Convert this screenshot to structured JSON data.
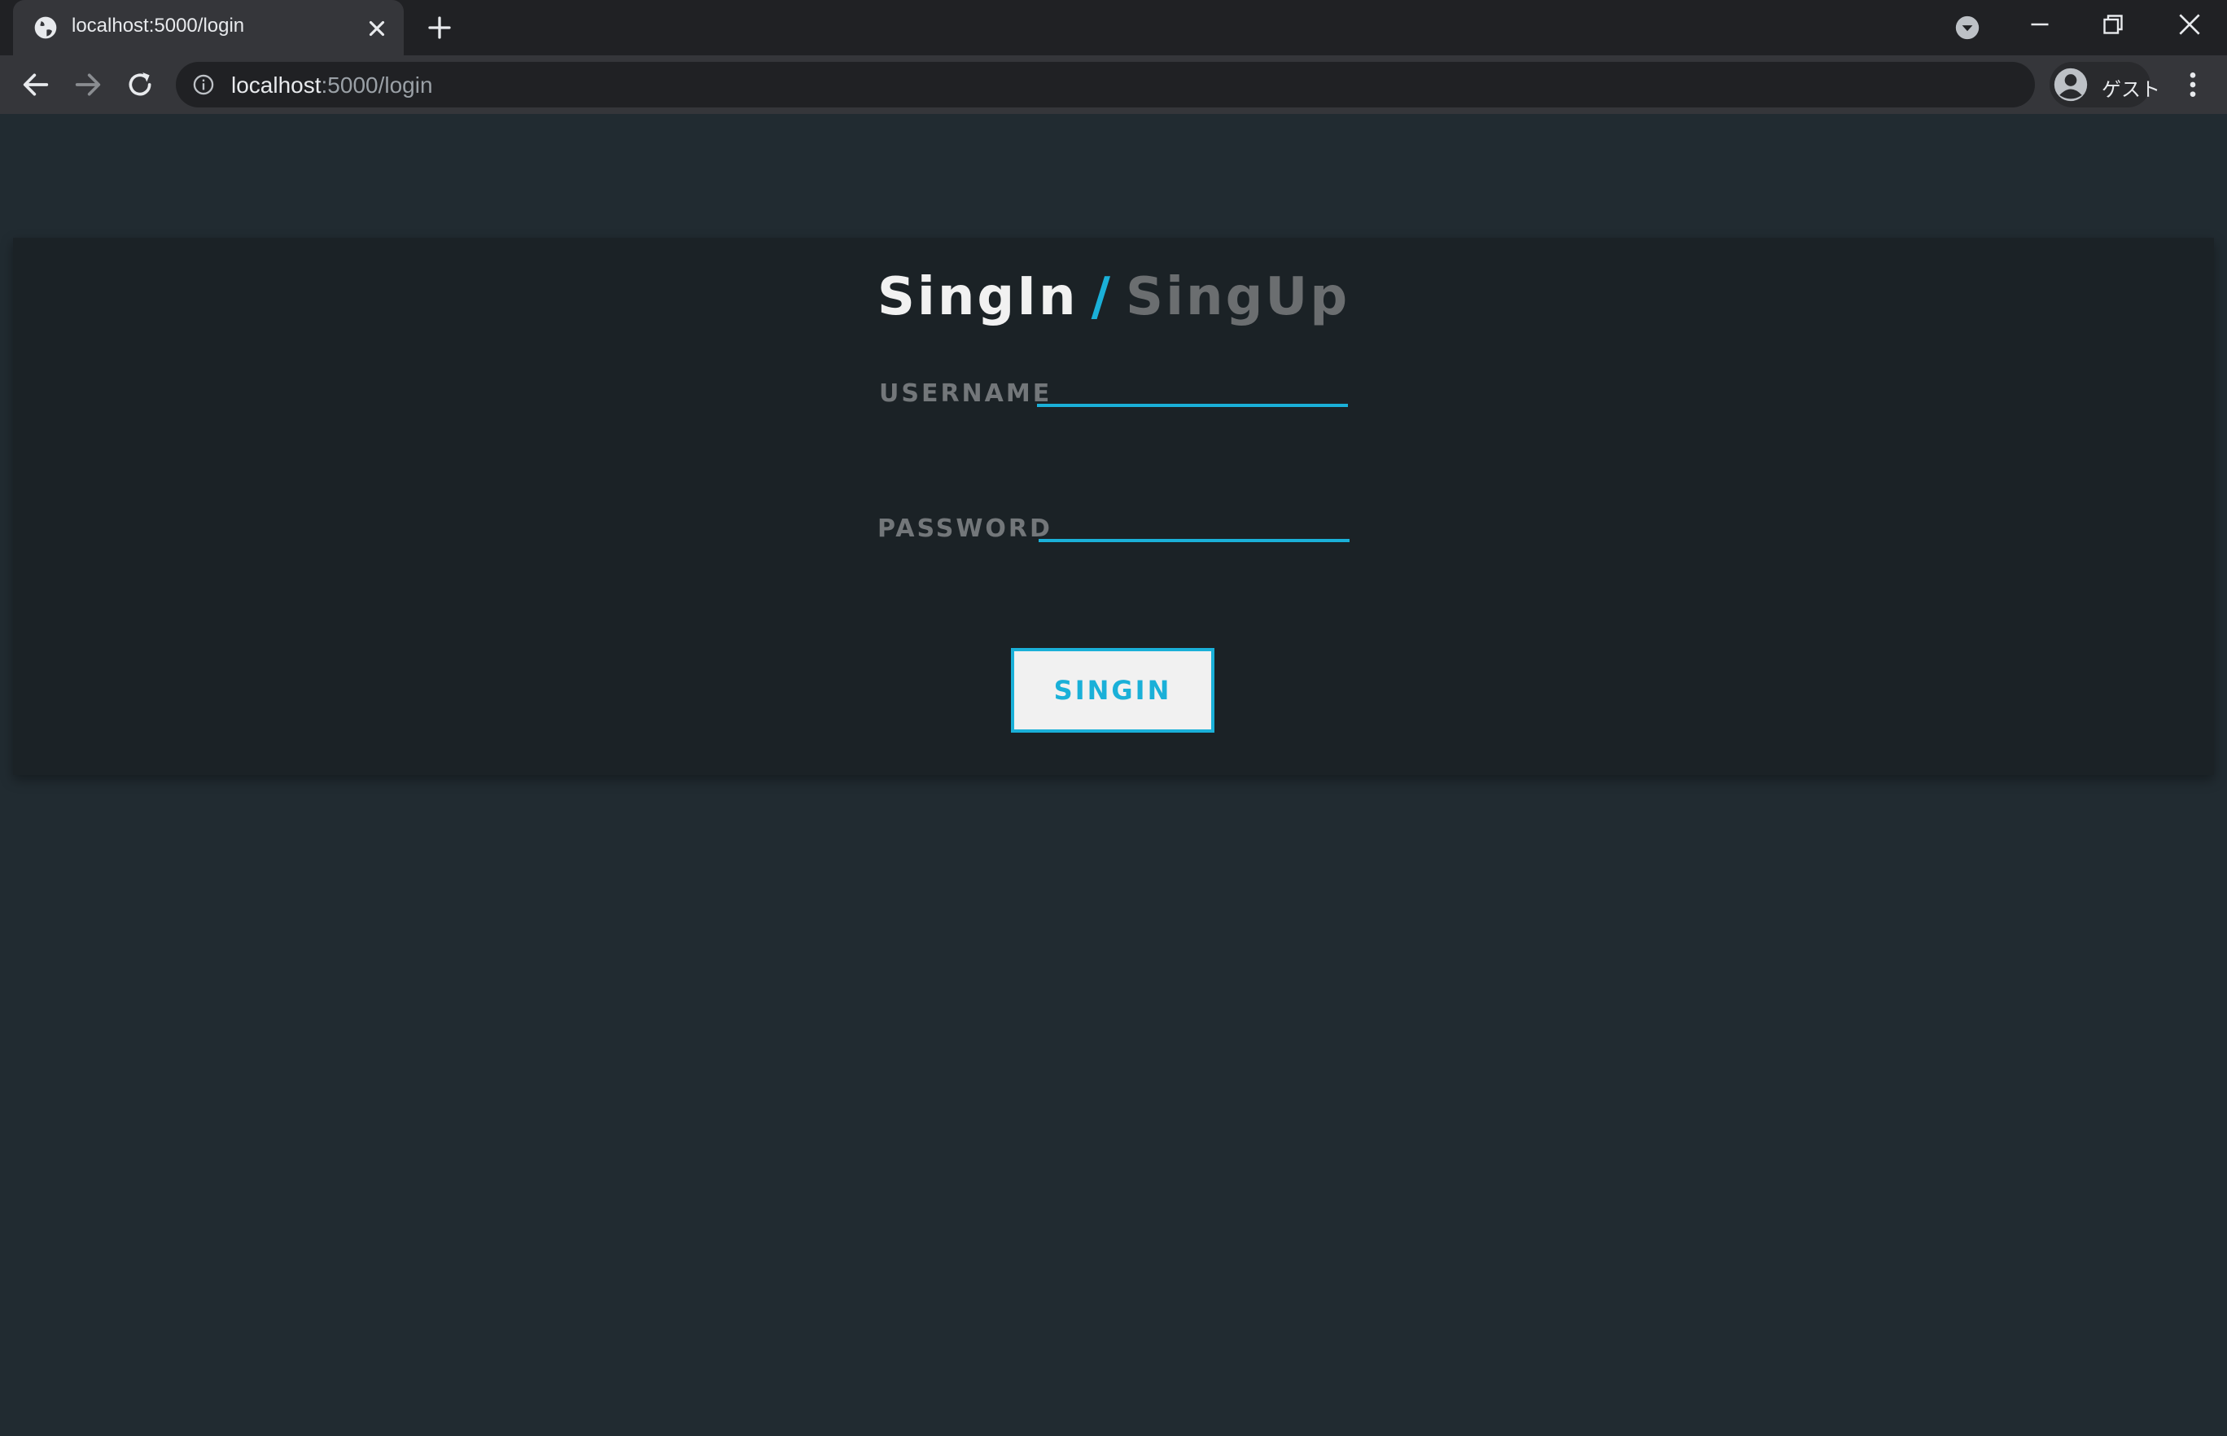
{
  "browser": {
    "tab_title": "localhost:5000/login",
    "url_host": "localhost",
    "url_path": ":5000/login",
    "profile_label": "ゲスト",
    "icons": {
      "favicon": "globe-icon",
      "tab_close": "close-icon",
      "new_tab": "plus-icon",
      "tab_search": "chevron-down-circle-icon",
      "minimize": "minimize-icon",
      "restore": "restore-icon",
      "close_window": "close-icon",
      "back": "arrow-left-icon",
      "forward": "arrow-right-icon",
      "reload": "reload-icon",
      "site_info": "info-icon",
      "avatar": "person-icon",
      "menu": "kebab-menu-icon"
    }
  },
  "login": {
    "heading_signin": "SingIn",
    "heading_separator": "/",
    "heading_signup": "SingUp",
    "username_label": "USERNAME",
    "username_value": "",
    "password_label": "PASSWORD",
    "password_value": "",
    "submit_label": "SINGIN"
  },
  "colors": {
    "page_background": "#212b31",
    "card_background": "#1b2226",
    "accent": "#1ab0d8",
    "heading_active": "#f1f1f1",
    "heading_inactive": "#6b6e70",
    "label": "#73777a"
  }
}
